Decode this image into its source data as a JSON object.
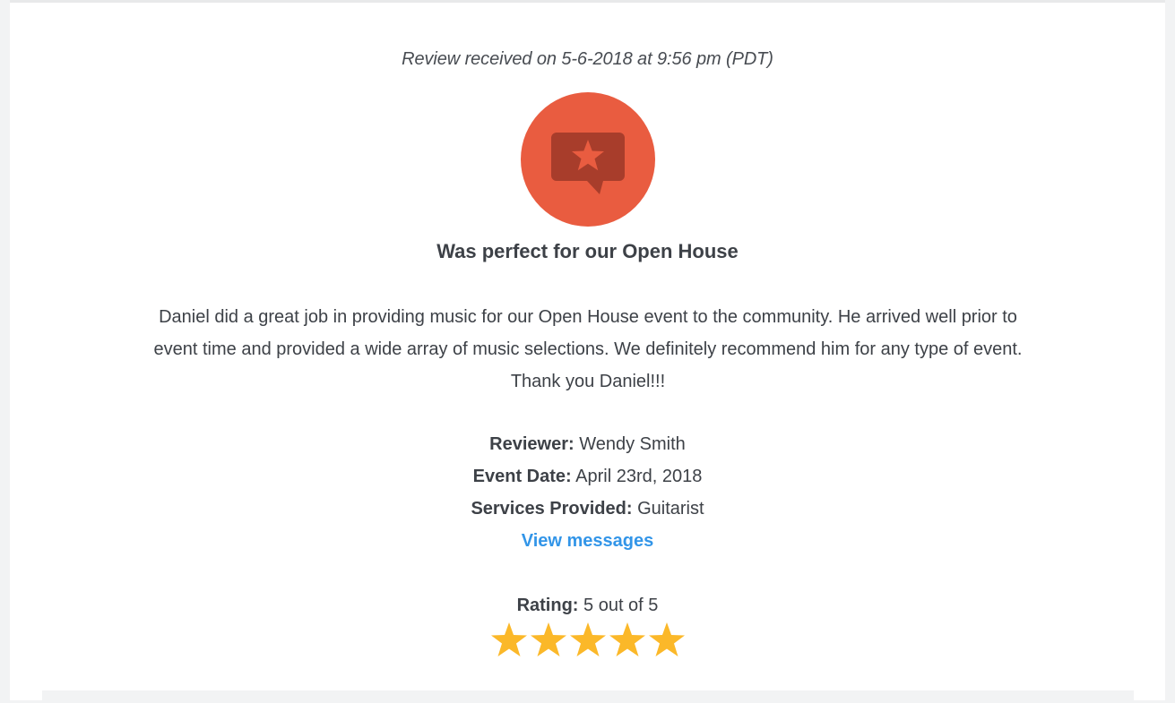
{
  "review": {
    "timestamp": "Review received on 5-6-2018 at 9:56 pm (PDT)",
    "badge_icon": "review-star-speech-bubble-icon",
    "headline": "Was perfect for our Open House",
    "body": "Daniel did a great job in providing music for our Open House event to the community. He arrived well prior to event time and provided a wide array of music selections. We definitely recommend him for any type of event. Thank you Daniel!!!",
    "reviewer_label": "Reviewer:",
    "reviewer_value": "Wendy Smith",
    "event_date_label": "Event Date:",
    "event_date_value": "April 23rd, 2018",
    "services_label": "Services Provided:",
    "services_value": "Guitarist",
    "view_messages_label": "View messages",
    "rating_label": "Rating:",
    "rating_value": "5 out of 5",
    "rating_stars": 5,
    "rating_max": 5
  },
  "colors": {
    "badge_bg": "#e95c40",
    "badge_icon": "#a83d2b",
    "star": "#fbb829",
    "link": "#3295e8",
    "text": "#3d4147"
  }
}
